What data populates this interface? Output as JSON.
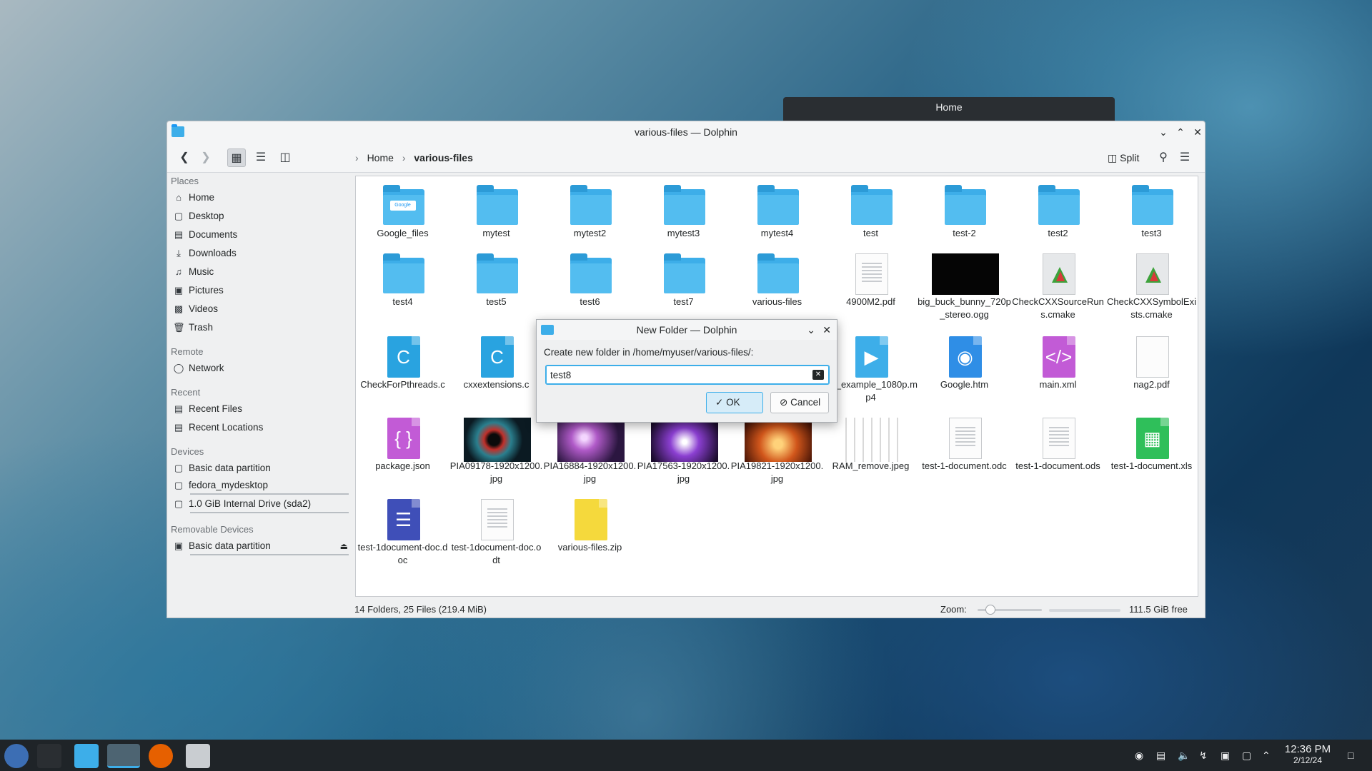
{
  "background_window": {
    "title": "Home"
  },
  "window": {
    "title": "various-files — Dolphin",
    "breadcrumb": [
      "Home",
      "various-files"
    ],
    "split_label": "Split"
  },
  "sidebar": {
    "places_header": "Places",
    "places": [
      "Home",
      "Desktop",
      "Documents",
      "Downloads",
      "Music",
      "Pictures",
      "Videos",
      "Trash"
    ],
    "remote_header": "Remote",
    "remote": [
      "Network"
    ],
    "recent_header": "Recent",
    "recent": [
      "Recent Files",
      "Recent Locations"
    ],
    "devices_header": "Devices",
    "devices": [
      "Basic data partition",
      "fedora_mydesktop",
      "1.0 GiB Internal Drive (sda2)"
    ],
    "removable_header": "Removable Devices",
    "removable": [
      "Basic data partition"
    ]
  },
  "files": [
    {
      "name": "Google_files",
      "kind": "folder-google"
    },
    {
      "name": "mytest",
      "kind": "folder"
    },
    {
      "name": "mytest2",
      "kind": "folder"
    },
    {
      "name": "mytest3",
      "kind": "folder"
    },
    {
      "name": "mytest4",
      "kind": "folder"
    },
    {
      "name": "test",
      "kind": "folder"
    },
    {
      "name": "test-2",
      "kind": "folder"
    },
    {
      "name": "test2",
      "kind": "folder"
    },
    {
      "name": "test3",
      "kind": "folder"
    },
    {
      "name": "test4",
      "kind": "folder"
    },
    {
      "name": "test5",
      "kind": "folder"
    },
    {
      "name": "test6",
      "kind": "folder"
    },
    {
      "name": "test7",
      "kind": "folder"
    },
    {
      "name": "various-files",
      "kind": "folder"
    },
    {
      "name": "4900M2.pdf",
      "kind": "pdf"
    },
    {
      "name": "big_buck_bunny_720p_stereo.ogg",
      "kind": "video"
    },
    {
      "name": "CheckCXXSourceRuns.cmake",
      "kind": "cmake"
    },
    {
      "name": "CheckCXXSymbolExists.cmake",
      "kind": "cmake"
    },
    {
      "name": "CheckForPthreads.c",
      "kind": "c"
    },
    {
      "name": "cxxextensions.c",
      "kind": "c"
    },
    {
      "name": "file_example_1080p.mp4",
      "kind": "mp4"
    },
    {
      "name": "Google.htm",
      "kind": "htm"
    },
    {
      "name": "main.xml",
      "kind": "xml"
    },
    {
      "name": "nag2.pdf",
      "kind": "blank"
    },
    {
      "name": "package.json",
      "kind": "json"
    },
    {
      "name": "PIA09178-1920x1200.jpg",
      "kind": "img-helix"
    },
    {
      "name": "PIA16884-1920x1200.jpg",
      "kind": "img-nebula"
    },
    {
      "name": "PIA17563-1920x1200.jpg",
      "kind": "img-purple"
    },
    {
      "name": "PIA19821-1920x1200.jpg",
      "kind": "img-sun"
    },
    {
      "name": "RAM_remove.jpeg",
      "kind": "img-ram"
    },
    {
      "name": "test-1-document.odc",
      "kind": "doc-lines"
    },
    {
      "name": "test-1-document.ods",
      "kind": "doc-lines"
    },
    {
      "name": "test-1-document.xls",
      "kind": "xls"
    },
    {
      "name": "test-1document-doc.doc",
      "kind": "doc"
    },
    {
      "name": "test-1document-doc.odt",
      "kind": "doc-lines"
    },
    {
      "name": "various-files.zip",
      "kind": "zip"
    }
  ],
  "status": {
    "summary": "14 Folders, 25 Files (219.4 MiB)",
    "zoom_label": "Zoom:",
    "free_space": "111.5 GiB free",
    "zoom_level": 0.2
  },
  "dialog": {
    "title": "New Folder — Dolphin",
    "label": "Create new folder in /home/myuser/various-files/:",
    "value": "test8",
    "ok_label": "OK",
    "cancel_label": "Cancel"
  },
  "taskbar": {
    "time": "12:36 PM",
    "date": "2/12/24"
  },
  "colors": {
    "accent": "#3daee9",
    "folder": "#53bdf0",
    "taskbar": "#1f2428"
  }
}
